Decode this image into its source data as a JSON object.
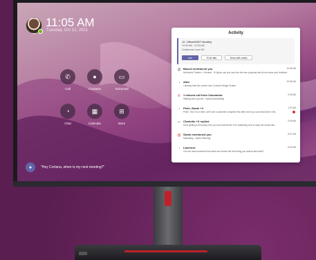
{
  "clock": {
    "time": "11:05 AM",
    "date": "Tuesday, Oct 12, 2021"
  },
  "presence": {
    "status_color": "#6bb700"
  },
  "apps": [
    {
      "label": "Call",
      "icon": "phone-icon"
    },
    {
      "label": "Contacts",
      "icon": "contacts-icon"
    },
    {
      "label": "Voicemail",
      "icon": "voicemail-icon"
    },
    {
      "label": "Chat",
      "icon": "chat-icon"
    },
    {
      "label": "Calendar",
      "icon": "calendar-icon"
    },
    {
      "label": "More",
      "icon": "more-icon"
    }
  ],
  "cortana": {
    "prompt": "\"Hey Cortana, when is my next meeting?\""
  },
  "activity": {
    "title": "Activity",
    "meeting": {
      "title": "12. Office/WWT Monthly",
      "time": "10:00 AM - 10:30 AM",
      "location": "Conference room 8/1",
      "join_label": "Join",
      "late_label": "I'll be late",
      "send_label": "Send with notes"
    },
    "items": [
      {
        "icon": "mention-icon",
        "title": "Bassel mentioned you",
        "sub": "Northwind Traders > General · Hi @you can you look into the new proposal and let me know your feedback?",
        "time": "10:55 AM",
        "unread": false
      },
      {
        "icon": "chat-icon",
        "title": "Aldo",
        "sub": "I already built the current new Console Design Scripts",
        "time": "10:55 AM",
        "unread": false
      },
      {
        "icon": "missed-call-icon",
        "title": "1 missed call from Cassandra",
        "sub": "Waiting call in queue · Hybrid accessibility",
        "time": "9:45 AM",
        "unread": false
      },
      {
        "icon": "chat-icon",
        "title": "Peter, Sarah +4",
        "sub": "Peter: Yes I'm on them, we'll see a customer complete this after more you can check like in the...",
        "time": "1:37 AM",
        "unread": true
      },
      {
        "icon": "reply-icon",
        "title": "Charlotte +3 replied",
        "sub": "Deck getting a bit messy, then you can include the 3 for mastering how to wrap the scrolls like...",
        "time": "9:09 AM",
        "unread": false
      },
      {
        "icon": "mention-icon",
        "title": "Sarah mentioned you",
        "sub": "Marketing > Sprint Planning",
        "time": "8:07 AM",
        "unread": false
      },
      {
        "icon": "chat-icon",
        "title": "Laurence",
        "sub": "Can we meet sometime this week and review the feed thing you shared last week?",
        "time": "8:00 AM",
        "unread": false
      }
    ]
  },
  "colors": {
    "accent": "#6264a7",
    "unread": "#d13438",
    "stand_accent": "#c0202a"
  }
}
